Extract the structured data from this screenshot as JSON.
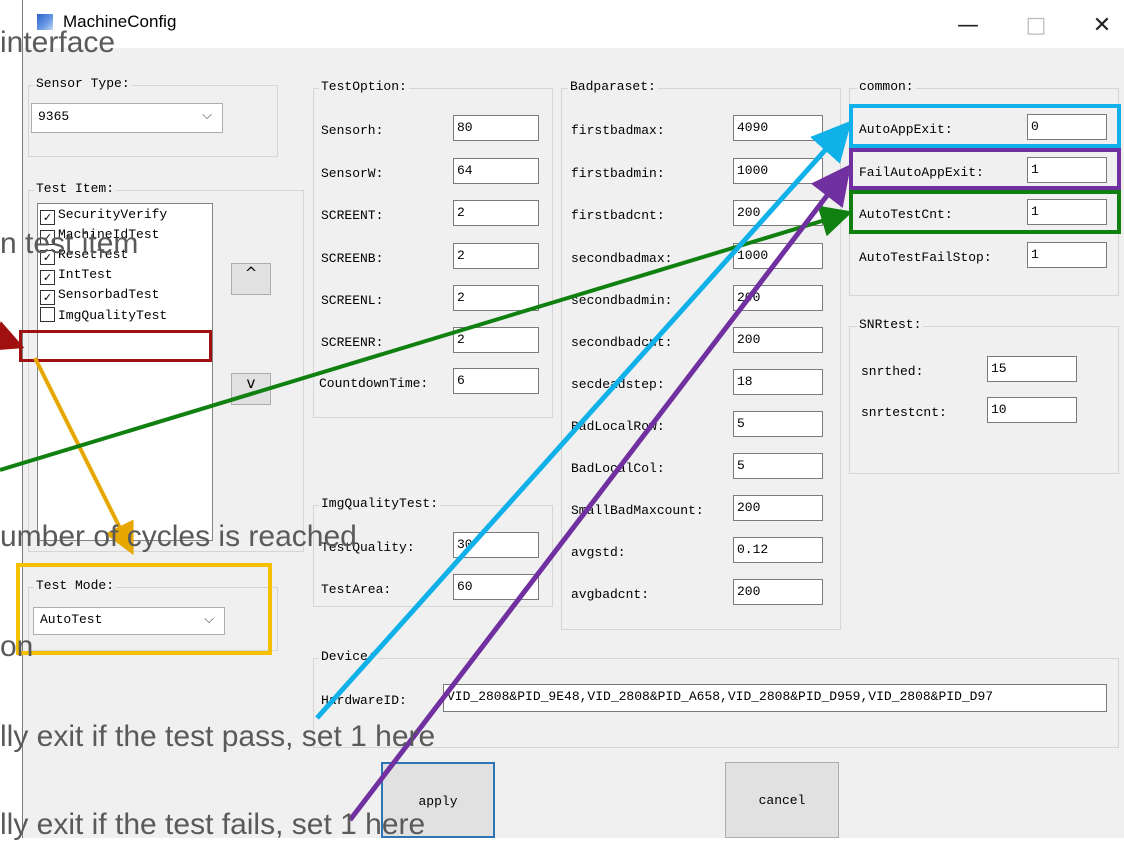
{
  "window": {
    "title": "MachineConfig",
    "min_label": "—",
    "max_label": "□",
    "close_label": "✕"
  },
  "sensor_type": {
    "label": "Sensor Type:",
    "value": "9365"
  },
  "test_item": {
    "label": "Test Item:",
    "items": [
      {
        "label": "SecurityVerify",
        "checked": true
      },
      {
        "label": "MachineIdTest",
        "checked": true
      },
      {
        "label": "ResetTest",
        "checked": true
      },
      {
        "label": "IntTest",
        "checked": true
      },
      {
        "label": "SensorbadTest",
        "checked": true
      },
      {
        "label": "ImgQualityTest",
        "checked": false
      }
    ],
    "up_label": "^",
    "down_label": "v"
  },
  "test_mode": {
    "label": "Test Mode:",
    "value": "AutoTest"
  },
  "test_option": {
    "label": "TestOption:",
    "fields": [
      {
        "label": "Sensorh:",
        "value": "80"
      },
      {
        "label": "SensorW:",
        "value": "64"
      },
      {
        "label": "SCREENT:",
        "value": "2"
      },
      {
        "label": "SCREENB:",
        "value": "2"
      },
      {
        "label": "SCREENL:",
        "value": "2"
      },
      {
        "label": "SCREENR:",
        "value": "2"
      },
      {
        "label": "CountdownTime:",
        "value": "6"
      }
    ]
  },
  "img_quality": {
    "label": "ImgQualityTest:",
    "fields": [
      {
        "label": "TestQuality:",
        "value": "30"
      },
      {
        "label": "TestArea:",
        "value": "60"
      }
    ]
  },
  "badparaset": {
    "label": "Badparaset:",
    "fields": [
      {
        "label": "firstbadmax:",
        "value": "4090"
      },
      {
        "label": "firstbadmin:",
        "value": "1000"
      },
      {
        "label": "firstbadcnt:",
        "value": "200"
      },
      {
        "label": "secondbadmax:",
        "value": "1000"
      },
      {
        "label": "secondbadmin:",
        "value": "200"
      },
      {
        "label": "secondbadcnt:",
        "value": "200"
      },
      {
        "label": "secdeadstep:",
        "value": "18"
      },
      {
        "label": "BadLocalRow:",
        "value": "5"
      },
      {
        "label": "BadLocalCol:",
        "value": "5"
      },
      {
        "label": "SmallBadMaxcount:",
        "value": "200"
      },
      {
        "label": "avgstd:",
        "value": "0.12"
      },
      {
        "label": "avgbadcnt:",
        "value": "200"
      }
    ]
  },
  "common": {
    "label": "common:",
    "fields": [
      {
        "label": "AutoAppExit:",
        "value": "0"
      },
      {
        "label": "FailAutoAppExit:",
        "value": "1"
      },
      {
        "label": "AutoTestCnt:",
        "value": "1"
      },
      {
        "label": "AutoTestFailStop:",
        "value": "1"
      }
    ]
  },
  "snrtest": {
    "label": "SNRtest:",
    "fields": [
      {
        "label": "snrthed:",
        "value": "15"
      },
      {
        "label": "snrtestcnt:",
        "value": "10"
      }
    ]
  },
  "device": {
    "label": "Device:",
    "hardware_label": "HardwareID:",
    "hardware_value": "VID_2808&PID_9E48,VID_2808&PID_A658,VID_2808&PID_D959,VID_2808&PID_D97"
  },
  "buttons": {
    "apply": "apply",
    "cancel": "cancel"
  },
  "callouts": {
    "interface": "interface",
    "test_item": "n test item",
    "cycles": "umber of cycles is reached",
    "on": "on",
    "pass": "lly exit if the test pass, set 1 here",
    "fails": "lly exit if the test fails, set 1 here"
  },
  "colors": {
    "red": "#a01010",
    "yellow": "#f5c000",
    "cyan": "#10b0e8",
    "purple": "#7030a0",
    "green": "#108010",
    "orange_arrow": "#e6a800",
    "blue_box": "#2e75b6"
  }
}
